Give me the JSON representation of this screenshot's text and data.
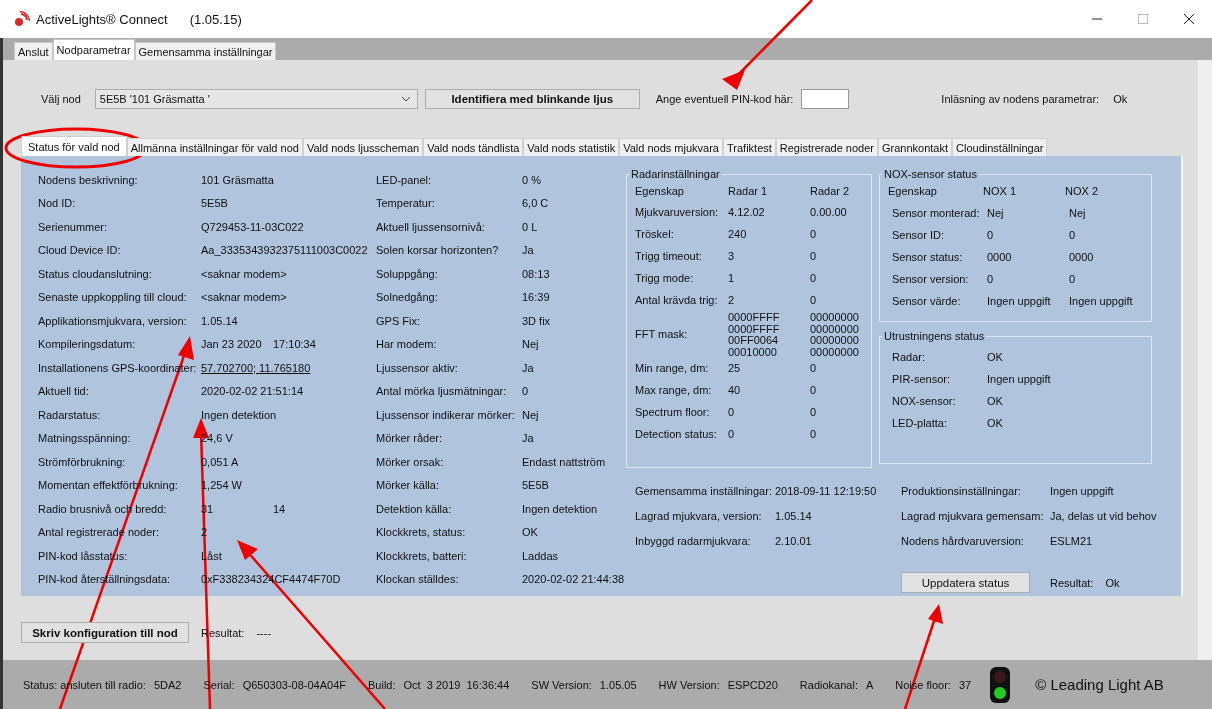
{
  "window": {
    "title": "ActiveLights® Connect",
    "version": "(1.05.15)"
  },
  "main_tabs": [
    {
      "label": "Anslut",
      "selected": false
    },
    {
      "label": "Nodparametrar",
      "selected": true
    },
    {
      "label": "Gemensamma inställningar",
      "selected": false
    }
  ],
  "node_select": {
    "label": "Välj nod",
    "value": "5E5B '101 Gräsmatta '"
  },
  "identify_button": "Identifiera med blinkande ljus",
  "pin": {
    "label": "Ange eventuell PIN-kod här:"
  },
  "load_status": {
    "label": "Inläsning av nodens parametrar:",
    "value": "Ok"
  },
  "sub_tabs": [
    {
      "label": "Status för vald nod",
      "selected": true
    },
    {
      "label": "Allmänna inställningar för vald nod",
      "selected": false
    },
    {
      "label": "Vald nods ljusscheman",
      "selected": false
    },
    {
      "label": "Vald nods tändlista",
      "selected": false
    },
    {
      "label": "Vald nods statistik",
      "selected": false
    },
    {
      "label": "Vald nods mjukvara",
      "selected": false
    },
    {
      "label": "Trafiktest",
      "selected": false
    },
    {
      "label": "Registrerade noder",
      "selected": false
    },
    {
      "label": "Grannkontakt",
      "selected": false
    },
    {
      "label": "Cloudinställningar",
      "selected": false
    }
  ],
  "status_left": [
    {
      "label": "Nodens beskrivning:",
      "values": [
        "101 Gräsmatta"
      ],
      "kind": "text"
    },
    {
      "label": "Nod ID:",
      "values": [
        "5E5B"
      ],
      "kind": "text"
    },
    {
      "label": "Serienummer:",
      "values": [
        "Q729453-11-03C022"
      ],
      "kind": "text"
    },
    {
      "label": "Cloud Device ID:",
      "values": [
        "Aa_3335343932375111003C0022"
      ],
      "kind": "text"
    },
    {
      "label": "Status cloudanslutning:",
      "values": [
        "<saknar modem>"
      ],
      "kind": "text"
    },
    {
      "label": "Senaste uppkoppling till cloud:",
      "values": [
        "<saknar modem>"
      ],
      "kind": "text"
    },
    {
      "label": "Applikationsmjukvara, version:",
      "values": [
        "1.05.14"
      ],
      "kind": "text"
    },
    {
      "label": "Kompileringsdatum:",
      "values": [
        "Jan 23 2020",
        "17:10:34"
      ],
      "kind": "text"
    },
    {
      "label": "Installationens GPS-koordinater:",
      "values": [
        "57.702700; 11.765180"
      ],
      "kind": "link"
    },
    {
      "label": "Aktuell tid:",
      "values": [
        "2020-02-02 21:51:14"
      ],
      "kind": "text"
    },
    {
      "label": "Radarstatus:",
      "values": [
        "Ingen detektion"
      ],
      "kind": "text"
    },
    {
      "label": "Matningsspänning:",
      "values": [
        "24,6 V"
      ],
      "kind": "text"
    },
    {
      "label": "Strömförbrukning:",
      "values": [
        "0,051 A"
      ],
      "kind": "text"
    },
    {
      "label": "Momentan effektförbrukning:",
      "values": [
        "1,254 W"
      ],
      "kind": "text"
    },
    {
      "label": "Radio brusnivå och bredd:",
      "values": [
        "31",
        "14"
      ],
      "kind": "text"
    },
    {
      "label": "Antal registrerade noder:",
      "values": [
        "2"
      ],
      "kind": "text"
    },
    {
      "label": "PIN-kod låsstatus:",
      "values": [
        "Låst"
      ],
      "kind": "text"
    },
    {
      "label": "PIN-kod återställningsdata:",
      "values": [
        "0xF338234324CF4474F70D"
      ],
      "kind": "text"
    }
  ],
  "status_right": [
    {
      "label": "LED-panel:",
      "value": "0 %"
    },
    {
      "label": "Temperatur:",
      "value": "6,0 C"
    },
    {
      "label": "Aktuell ljussensornivå:",
      "value": "0 L"
    },
    {
      "label": "Solen korsar horizonten?",
      "value": "Ja"
    },
    {
      "label": "Soluppgång:",
      "value": "08:13"
    },
    {
      "label": "Solnedgång:",
      "value": "16:39"
    },
    {
      "label": "GPS Fix:",
      "value": "3D fix"
    },
    {
      "label": "Har modem:",
      "value": "Nej"
    },
    {
      "label": "Ljussensor aktiv:",
      "value": "Ja"
    },
    {
      "label": "Antal mörka ljusmätningar:",
      "value": "0"
    },
    {
      "label": "Ljussensor indikerar mörker:",
      "value": "Nej"
    },
    {
      "label": "Mörker råder:",
      "value": "Ja"
    },
    {
      "label": "Mörker orsak:",
      "value": "Endast nattström"
    },
    {
      "label": "Mörker källa:",
      "value": "5E5B"
    },
    {
      "label": "Detektion källa:",
      "value": "Ingen detektion"
    },
    {
      "label": "Klockkrets, status:",
      "value": "OK"
    },
    {
      "label": "Klockkrets, batteri:",
      "value": "Laddas"
    },
    {
      "label": "Klockan ställdes:",
      "value": "2020-02-02 21:44:38"
    }
  ],
  "radar": {
    "title": "Radarinställningar",
    "columns": [
      "Egenskap",
      "Radar 1",
      "Radar 2"
    ],
    "rows": [
      [
        "Mjukvaruversion:",
        "4.12.02",
        "0.00.00"
      ],
      [
        "Tröskel:",
        "240",
        "0"
      ],
      [
        "Trigg timeout:",
        "3",
        "0"
      ],
      [
        "Trigg mode:",
        "1",
        "0"
      ],
      [
        "Antal krävda trig:",
        "2",
        "0"
      ],
      [
        "FFT mask:",
        "0000FFFF\n0000FFFF\n00FF0064\n00010000",
        "00000000\n00000000\n00000000\n00000000"
      ],
      [
        "Min range, dm:",
        "25",
        "0"
      ],
      [
        "Max range, dm:",
        "40",
        "0"
      ],
      [
        "Spectrum floor:",
        "0",
        "0"
      ],
      [
        "Detection status:",
        "0",
        "0"
      ]
    ]
  },
  "nox": {
    "title": "NOX-sensor status",
    "columns": [
      "Egenskap",
      "NOX 1",
      "NOX 2"
    ],
    "rows": [
      [
        "Sensor monterad:",
        "Nej",
        "Nej"
      ],
      [
        "Sensor ID:",
        "0",
        "0"
      ],
      [
        "Sensor status:",
        "0000",
        "0000"
      ],
      [
        "Sensor version:",
        "0",
        "0"
      ],
      [
        "Sensor värde:",
        "Ingen uppgift",
        "Ingen uppgift"
      ]
    ]
  },
  "equipment": {
    "title": "Utrustningens status",
    "rows": [
      [
        "Radar:",
        "OK"
      ],
      [
        "PIR-sensor:",
        "Ingen uppgift"
      ],
      [
        "NOX-sensor:",
        "OK"
      ],
      [
        "LED-platta:",
        "OK"
      ]
    ]
  },
  "info_left": [
    {
      "label": "Gemensamma inställningar:",
      "value": "2018-09-11 12:19:50"
    },
    {
      "label": "Lagrad mjukvara, version:",
      "value": "1.05.14"
    },
    {
      "label": "Inbyggd radarmjukvara:",
      "value": "2.10.01"
    }
  ],
  "info_right": [
    {
      "label": "Produktionsinställningar:",
      "value": "Ingen uppgift"
    },
    {
      "label": "Lagrad mjukvara gemensam:",
      "value": "Ja, delas ut vid behov"
    },
    {
      "label": "Nodens hårdvaruversion:",
      "value": "ESLM21"
    }
  ],
  "update_button": "Uppdatera status",
  "update_result": {
    "label": "Resultat:",
    "value": "Ok"
  },
  "write_button": "Skriv konfiguration till nod",
  "write_result": {
    "label": "Resultat:",
    "value": "----"
  },
  "status_bar": [
    {
      "label": "Status: ansluten till radio:",
      "value": "5DA2"
    },
    {
      "label": "Serial:",
      "value": "Q650303-08-04A04F"
    },
    {
      "label": "Build:",
      "value": "Oct  3 2019  16:36:44"
    },
    {
      "label": "SW Version:",
      "value": "1.05.05"
    },
    {
      "label": "HW Version:",
      "value": "ESPCD20"
    },
    {
      "label": "Radiokanal:",
      "value": "A"
    },
    {
      "label": "Noise floor:",
      "value": "37"
    }
  ],
  "traffic_light": {
    "red_lit": false,
    "green_lit": true
  },
  "copyright": "© Leading Light AB"
}
